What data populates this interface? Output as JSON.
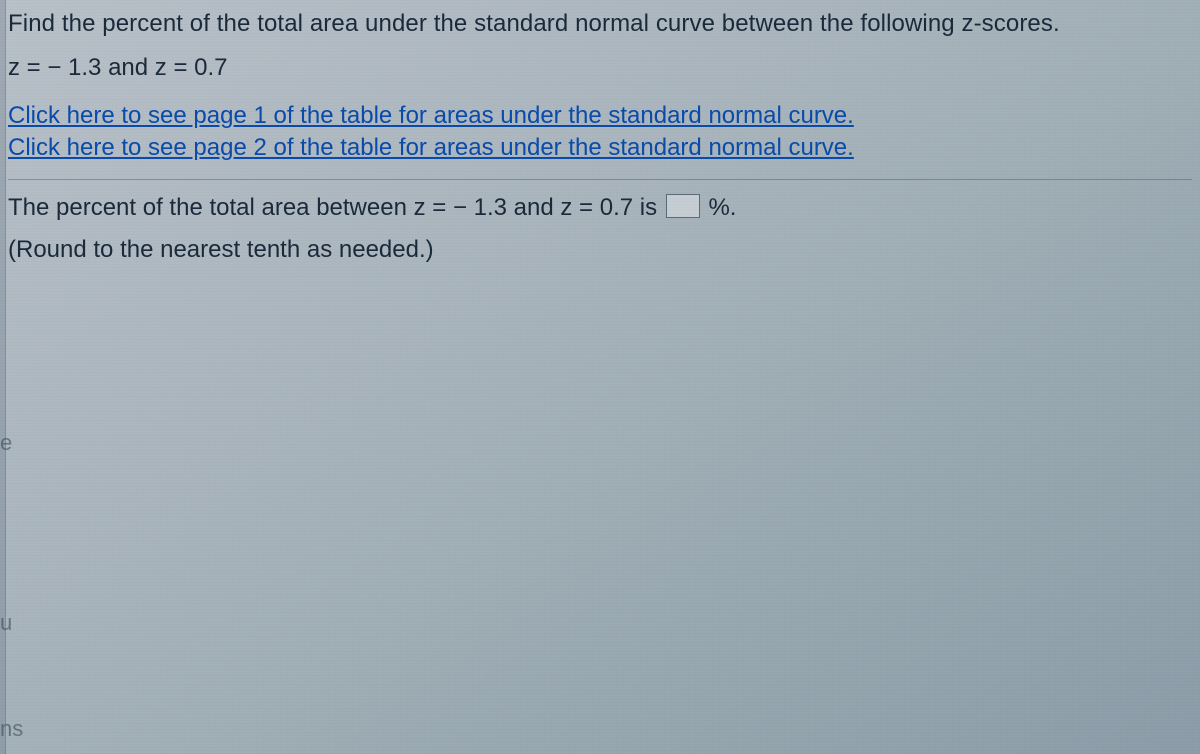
{
  "question": {
    "line1": "Find the percent of the total area under the standard normal curve between the following z-scores.",
    "line2": "z = − 1.3 and z = 0.7"
  },
  "links": {
    "page1": "Click here to see page 1 of the table for areas under the standard normal curve.",
    "page2": "Click here to see page 2 of the table for areas under the standard normal curve."
  },
  "answer": {
    "prefix": "The percent of the total area between z = − 1.3 and z = 0.7 is ",
    "suffix": "%.",
    "note": "(Round to the nearest tenth as needed.)"
  },
  "edge_fragments": {
    "e": "e",
    "u": "u",
    "ns": "ns"
  }
}
